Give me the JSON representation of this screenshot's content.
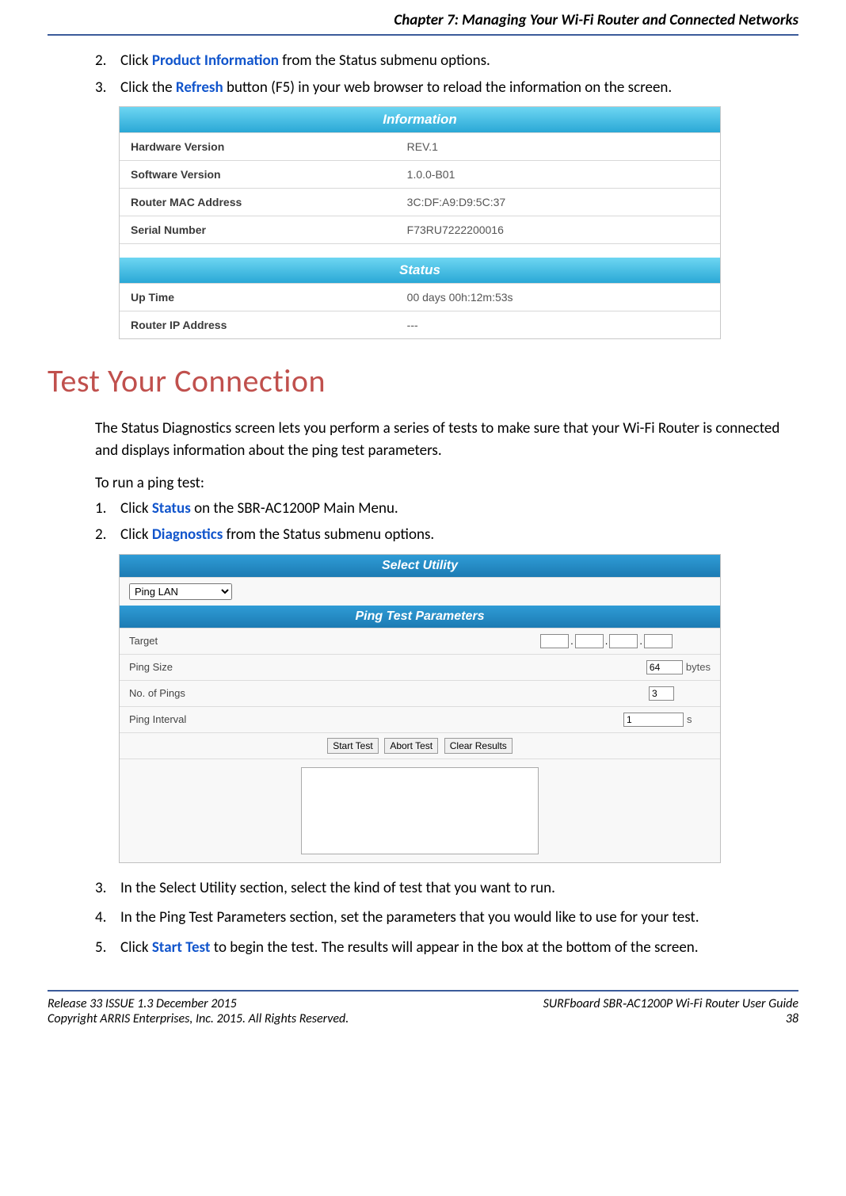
{
  "header": {
    "chapter": "Chapter 7: Managing Your Wi-Fi Router and Connected Networks"
  },
  "top_list": {
    "item2_num": "2.",
    "item2_pre": "Click ",
    "item2_bold": "Product Information",
    "item2_post": " from the Status submenu options.",
    "item3_num": "3.",
    "item3_pre": "Click the ",
    "item3_bold": "Refresh",
    "item3_post": " button (F5) in your web browser to reload the information on the screen."
  },
  "info_table": {
    "header": "Information",
    "rows": [
      {
        "label": "Hardware Version",
        "value": "REV.1"
      },
      {
        "label": "Software Version",
        "value": "1.0.0-B01"
      },
      {
        "label": "Router MAC Address",
        "value": "3C:DF:A9:D9:5C:37"
      },
      {
        "label": "Serial Number",
        "value": "F73RU7222200016"
      }
    ]
  },
  "status_table": {
    "header": "Status",
    "rows": [
      {
        "label": "Up Time",
        "value": "00 days 00h:12m:53s"
      },
      {
        "label": "Router IP Address",
        "value": "---"
      }
    ]
  },
  "section_heading": "Test Your Connection",
  "paragraph1": "The Status Diagnostics screen lets you perform a series of tests to make sure that your Wi-Fi Router is connected and displays information about the ping test parameters.",
  "paragraph2": "To run a ping test:",
  "ping_steps_top": {
    "s1_num": "1.",
    "s1_pre": "Click ",
    "s1_bold": "Status",
    "s1_post": " on the SBR-AC1200P Main Menu.",
    "s2_num": "2.",
    "s2_pre": "Click ",
    "s2_bold": "Diagnostics",
    "s2_post": " from the Status submenu options."
  },
  "ping_fig": {
    "select_header": "Select Utility",
    "select_value": "Ping LAN",
    "params_header": "Ping Test Parameters",
    "rows": {
      "target": "Target",
      "ping_size": "Ping Size",
      "ping_size_val": "64",
      "ping_size_unit": "bytes",
      "num_pings": "No. of Pings",
      "num_pings_val": "3",
      "ping_interval": "Ping Interval",
      "ping_interval_val": "1",
      "ping_interval_unit": "s"
    },
    "buttons": {
      "start": "Start Test",
      "abort": "Abort Test",
      "clear": "Clear Results"
    }
  },
  "ping_steps_bottom": {
    "s3_num": "3.",
    "s3_text": "In the Select Utility section, select the kind of test that you want to run.",
    "s4_num": "4.",
    "s4_text": "In the Ping Test Parameters section, set the parameters that you would like to use for your test.",
    "s5_num": "5.",
    "s5_pre": "Click ",
    "s5_bold": "Start Test",
    "s5_post": " to begin the test.  The results will appear in the box at the bottom of the screen."
  },
  "footer": {
    "left1": "Release 33 ISSUE 1.3    December 2015",
    "right1": "SURFboard SBR‑AC1200P Wi-Fi Router User Guide",
    "left2": "Copyright ARRIS Enterprises, Inc. 2015. All Rights Reserved.",
    "right2": "38"
  }
}
